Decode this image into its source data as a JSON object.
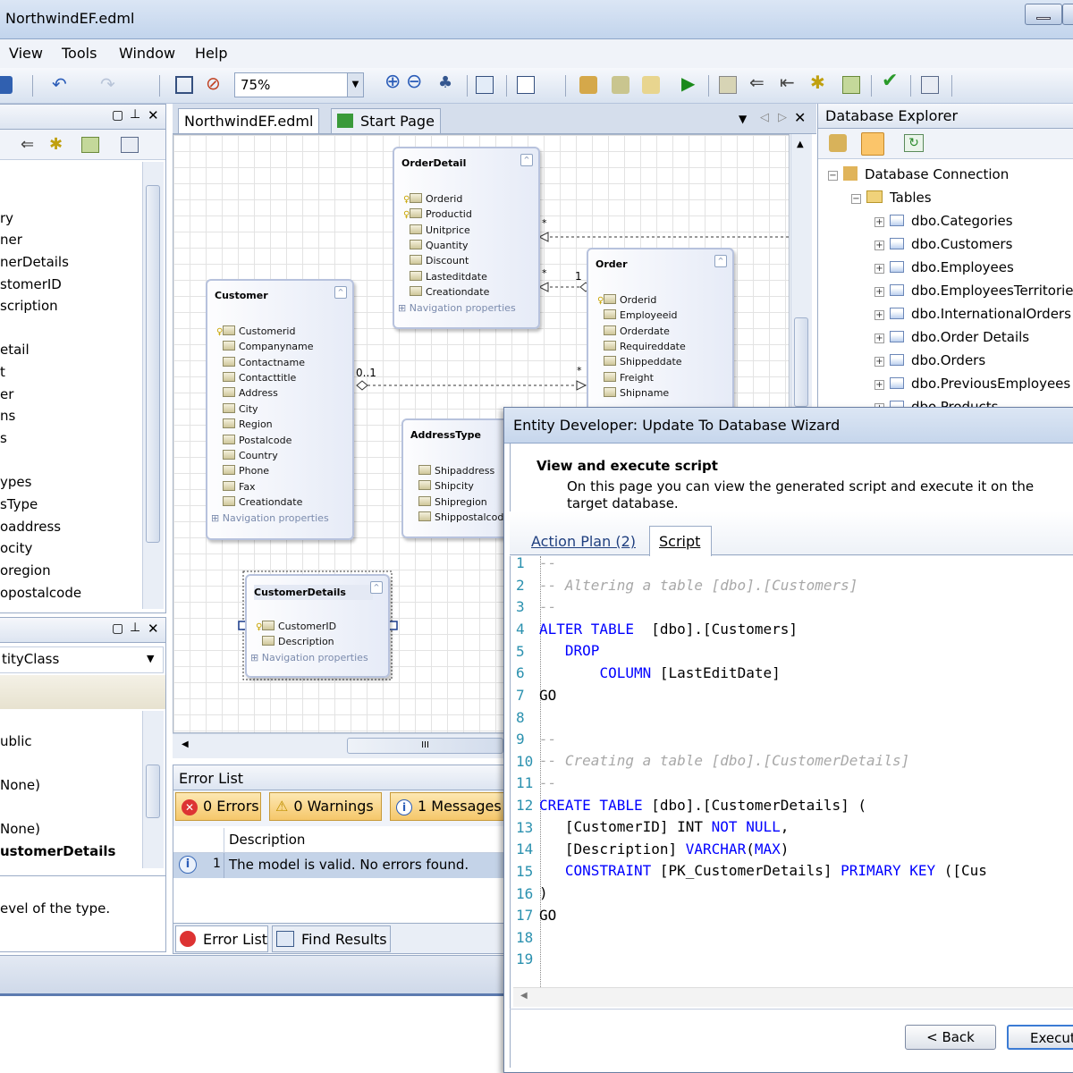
{
  "window": {
    "title": "NorthwindEF.edml"
  },
  "menu": {
    "view": "View",
    "tools": "Tools",
    "window": "Window",
    "help": "Help"
  },
  "toolbar": {
    "zoom": "75%"
  },
  "left_panel": {
    "items": [
      "ry",
      "ner",
      "nerDetails",
      "stomerID",
      "scription",
      "etail",
      "t",
      "er",
      "ns",
      "s",
      "ypes",
      "sType",
      "oaddress",
      "ocity",
      "oregion",
      "opostalcode"
    ]
  },
  "props_panel": {
    "selector": "tityClass",
    "rows": [
      "ublic",
      "None)",
      "None)",
      "ustomerDetails"
    ],
    "description": "evel of the type."
  },
  "tabs": {
    "doc": "NorthwindEF.edml",
    "start": "Start Page"
  },
  "entities": {
    "orderdetail": {
      "name": "OrderDetail",
      "props": [
        "Orderid",
        "Productid",
        "Unitprice",
        "Quantity",
        "Discount",
        "Lasteditdate",
        "Creationdate"
      ],
      "nav": "Navigation properties"
    },
    "order": {
      "name": "Order",
      "props": [
        "Orderid",
        "Employeeid",
        "Orderdate",
        "Requireddate",
        "Shippeddate",
        "Freight",
        "Shipname"
      ]
    },
    "customer": {
      "name": "Customer",
      "props": [
        "Customerid",
        "Companyname",
        "Contactname",
        "Contacttitle",
        "Address",
        "City",
        "Region",
        "Postalcode",
        "Country",
        "Phone",
        "Fax",
        "Creationdate"
      ],
      "nav": "Navigation properties"
    },
    "addresstype": {
      "name": "AddressType",
      "props": [
        "Shipaddress",
        "Shipcity",
        "Shipregion",
        "Shippostalcod"
      ]
    },
    "customerdetails": {
      "name": "CustomerDetails",
      "props": [
        "CustomerID",
        "Description"
      ],
      "nav": "Navigation properties"
    }
  },
  "multiplicity": {
    "star1": "*",
    "star2": "*",
    "one": "1",
    "zero_one": "0..1",
    "star3": "*"
  },
  "db_explorer": {
    "title": "Database Explorer",
    "connection": "Database Connection",
    "tables": "Tables",
    "items": [
      "dbo.Categories",
      "dbo.Customers",
      "dbo.Employees",
      "dbo.EmployeesTerritories",
      "dbo.InternationalOrders",
      "dbo.Order Details",
      "dbo.Orders",
      "dbo.PreviousEmployees",
      "dbo.Products"
    ]
  },
  "error_list": {
    "title": "Error List",
    "errors": "0 Errors",
    "warnings": "0 Warnings",
    "messages": "1 Messages",
    "col_desc": "Description",
    "row_num": "1",
    "row_text": "The model is valid. No errors found.",
    "tab_errors": "Error List",
    "tab_find": "Find Results"
  },
  "dialog": {
    "title": "Entity Developer: Update To Database Wizard",
    "heading": "View and execute script",
    "subtitle_1": "On this page you can view the generated script and execute it on the",
    "subtitle_2": "target database.",
    "tab_plan": "Action Plan (2)",
    "tab_script": "Script",
    "back": "< Back",
    "execute": "Execute"
  },
  "script_lines": [
    "1",
    "2",
    "3",
    "4",
    "5",
    "6",
    "7",
    "8",
    "9",
    "10",
    "11",
    "12",
    "13",
    "14",
    "15",
    "16",
    "17",
    "18",
    "19"
  ]
}
